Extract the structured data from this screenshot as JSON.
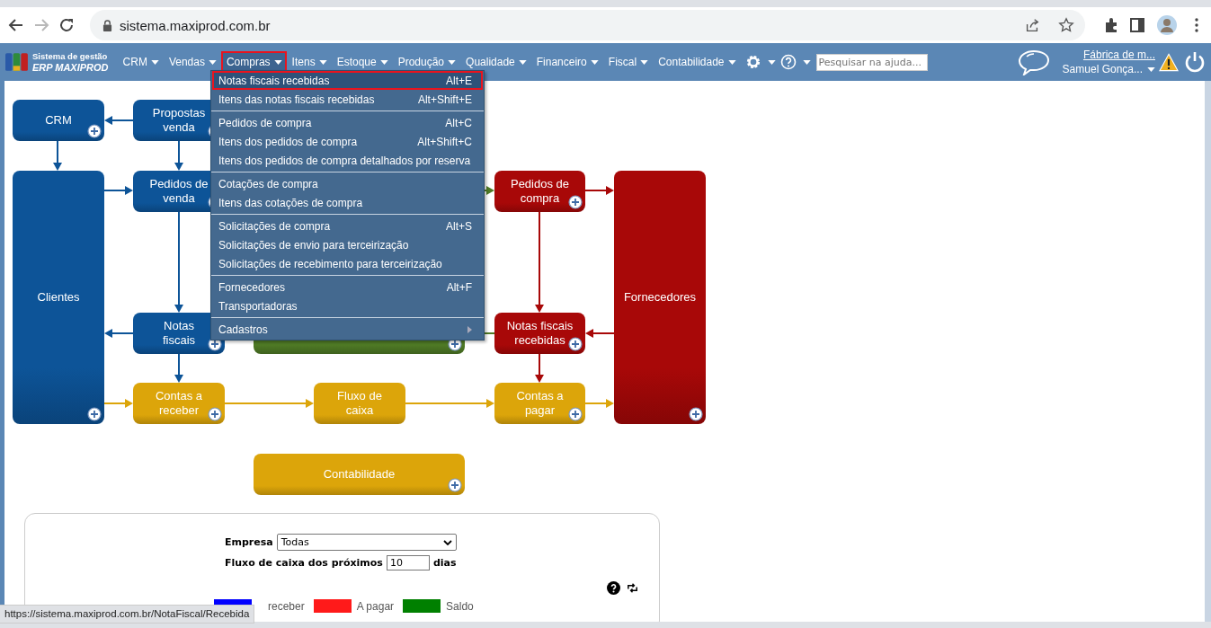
{
  "browser": {
    "address": "sistema.maxiprod.com.br",
    "forward_disabled": true,
    "status_url": "https://sistema.maxiprod.com.br/NotaFiscal/Recebida"
  },
  "app": {
    "logo_line1": "Sistema de gestão",
    "logo_line2": "ERP MAXIPROD",
    "nav": [
      {
        "label": "CRM",
        "selected": false
      },
      {
        "label": "Vendas",
        "selected": false
      },
      {
        "label": "Compras",
        "selected": true
      },
      {
        "label": "Itens",
        "selected": false
      },
      {
        "label": "Estoque",
        "selected": false
      },
      {
        "label": "Produção",
        "selected": false
      },
      {
        "label": "Qualidade",
        "selected": false
      },
      {
        "label": "Financeiro",
        "selected": false
      },
      {
        "label": "Fiscal",
        "selected": false
      },
      {
        "label": "Contabilidade",
        "selected": false
      }
    ],
    "search_placeholder": "Pesquisar na ajuda...",
    "company": "Fábrica de m...",
    "user": "Samuel Gonça..."
  },
  "menu": {
    "groups": [
      [
        {
          "label": "Notas fiscais recebidas",
          "shortcut": "Alt+E",
          "selected": true
        },
        {
          "label": "Itens das notas fiscais recebidas",
          "shortcut": "Alt+Shift+E",
          "selected": false
        }
      ],
      [
        {
          "label": "Pedidos de compra",
          "shortcut": "Alt+C",
          "selected": false
        },
        {
          "label": "Itens dos pedidos de compra",
          "shortcut": "Alt+Shift+C",
          "selected": false
        },
        {
          "label": "Itens dos pedidos de compra detalhados por reserva",
          "selected": false
        }
      ],
      [
        {
          "label": "Cotações de compra",
          "selected": false
        },
        {
          "label": "Itens das cotações de compra",
          "selected": false
        }
      ],
      [
        {
          "label": "Solicitações de compra",
          "shortcut": "Alt+S",
          "selected": false
        },
        {
          "label": "Solicitações de envio para terceirização",
          "selected": false
        },
        {
          "label": "Solicitações de recebimento para terceirização",
          "selected": false
        }
      ],
      [
        {
          "label": "Fornecedores",
          "shortcut": "Alt+F",
          "selected": false
        },
        {
          "label": "Transportadoras",
          "selected": false
        }
      ],
      [
        {
          "label": "Cadastros",
          "kind": "submenu",
          "selected": false
        }
      ]
    ]
  },
  "diagram": {
    "nodes": [
      {
        "label": "CRM",
        "color": "#0d5498",
        "plus": true
      },
      {
        "label": "Propostas venda",
        "color": "#0d5498",
        "plus": true
      },
      {
        "label": "Clientes",
        "color": "#0d5498",
        "plus": true
      },
      {
        "label": "Pedidos de venda",
        "color": "#0d5498",
        "plus": true
      },
      {
        "label": "Notas fiscais",
        "color": "#0d5498",
        "plus": true
      },
      {
        "color": "#4f7a25",
        "plus": true
      },
      {
        "label": "Pedidos de compra",
        "color": "#a80808",
        "plus": true
      },
      {
        "label": "Notas fiscais recebidas",
        "color": "#a80808",
        "plus": true
      },
      {
        "label": "Fornecedores",
        "color": "#a80808",
        "plus": true
      },
      {
        "label": "Contas a receber",
        "color": "#dca50a",
        "plus": true
      },
      {
        "label": "Fluxo de caixa",
        "color": "#dca50a",
        "plus": false
      },
      {
        "label": "Contas a pagar",
        "color": "#dca50a",
        "plus": true
      },
      {
        "label": "Contabilidade",
        "color": "#dca50a",
        "plus": true
      }
    ]
  },
  "cashflow": {
    "company_label": "Empresa",
    "company_value": "Todas",
    "days_label": "Fluxo de caixa dos próximos",
    "days_value": "10",
    "days_unit": "dias",
    "legend": [
      {
        "label": "receber",
        "color": "#0000ff"
      },
      {
        "label": "A pagar",
        "color": "#ff1a1a"
      },
      {
        "label": "Saldo",
        "color": "#008000"
      }
    ]
  }
}
